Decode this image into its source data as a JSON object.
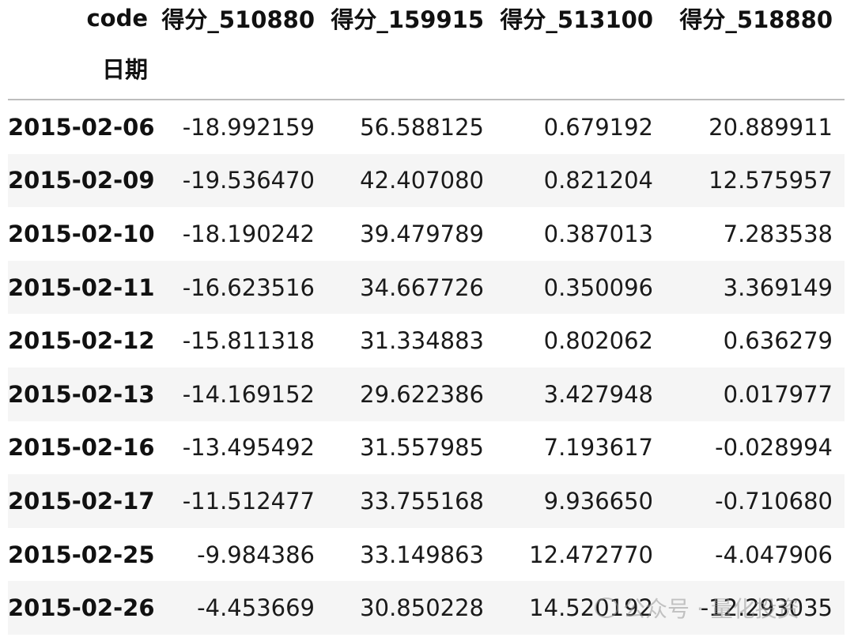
{
  "table": {
    "columns_label": "code",
    "index_label": "日期",
    "columns": [
      "得分_510880",
      "得分_159915",
      "得分_513100",
      "得分_518880"
    ],
    "rows": [
      {
        "date": "2015-02-06",
        "values": [
          "-18.992159",
          "56.588125",
          "0.679192",
          "20.889911"
        ]
      },
      {
        "date": "2015-02-09",
        "values": [
          "-19.536470",
          "42.407080",
          "0.821204",
          "12.575957"
        ]
      },
      {
        "date": "2015-02-10",
        "values": [
          "-18.190242",
          "39.479789",
          "0.387013",
          "7.283538"
        ]
      },
      {
        "date": "2015-02-11",
        "values": [
          "-16.623516",
          "34.667726",
          "0.350096",
          "3.369149"
        ]
      },
      {
        "date": "2015-02-12",
        "values": [
          "-15.811318",
          "31.334883",
          "0.802062",
          "0.636279"
        ]
      },
      {
        "date": "2015-02-13",
        "values": [
          "-14.169152",
          "29.622386",
          "3.427948",
          "0.017977"
        ]
      },
      {
        "date": "2015-02-16",
        "values": [
          "-13.495492",
          "31.557985",
          "7.193617",
          "-0.028994"
        ]
      },
      {
        "date": "2015-02-17",
        "values": [
          "-11.512477",
          "33.755168",
          "9.936650",
          "-0.710680"
        ]
      },
      {
        "date": "2015-02-25",
        "values": [
          "-9.984386",
          "33.149863",
          "12.472770",
          "-4.047906"
        ]
      },
      {
        "date": "2015-02-26",
        "values": [
          "-4.453669",
          "30.850228",
          "14.520192",
          "-12.293035"
        ]
      }
    ]
  },
  "watermark": {
    "text": "公众号 · 量化投资"
  }
}
